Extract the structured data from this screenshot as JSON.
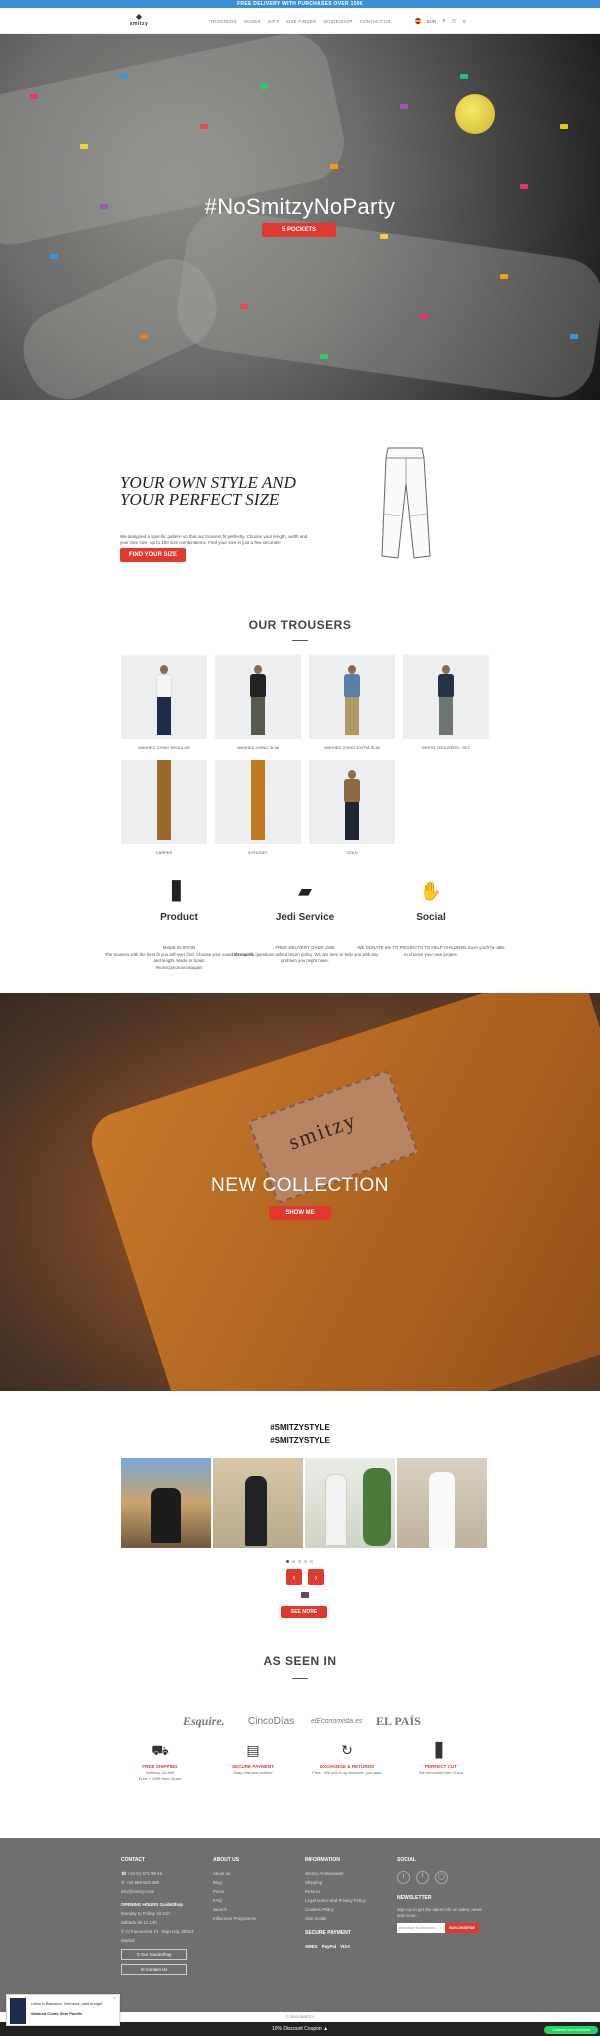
{
  "topbar": {
    "text": "FREE DELIVERY WITH PURCHASES OVER 150€"
  },
  "header": {
    "logo": "smitzy",
    "nav": [
      "TROUSERS",
      "SHOES",
      "GIFT",
      "SIZE FINDER",
      "GUIDESHOP",
      "CONTACT US"
    ],
    "lang": "EUR",
    "cart_count": "0",
    "icons": [
      "spain-flag-icon",
      "search-icon",
      "cart-icon"
    ]
  },
  "hero": {
    "title": "#NoSmitzyNoParty",
    "button": "5 POCKETS"
  },
  "style": {
    "title": "YOUR OWN STYLE AND YOUR PERFECT SIZE",
    "desc": "We designed a specific pattern so that our trousers fit perfectly. Choose your length, width and your own size, up to 150 size combinations. Find your size in just a few seconds!",
    "button": "FIND YOUR SIZE"
  },
  "trousers": {
    "title": "OUR TROUSERS",
    "items": [
      {
        "label": "WASHED CHINO REGULAR"
      },
      {
        "label": "WASHED CHINO SLIM"
      },
      {
        "label": "WASHED CHINO EXTRA SLIM"
      },
      {
        "label": "DRESS TROUSERS - SET"
      },
      {
        "label": "CARPER"
      },
      {
        "label": "5 POCKET"
      },
      {
        "label": "GOLD"
      }
    ]
  },
  "features": [
    {
      "title": "Product",
      "icon": "trousers-icon",
      "lines": [
        "MADE IN SPAIN",
        "The trousers with the best fit you will ever find. Choose your exact size-width and length. Made in Spain",
        "#nomitzynomarcisiagain"
      ]
    },
    {
      "title": "Jedi Service",
      "icon": "vest-icon",
      "lines": [
        "FREE DELIVERY OVER 150€",
        "150 days to questions asked return policy. We are here to help you with any problem you might have."
      ]
    },
    {
      "title": "Social",
      "icon": "hand-icon",
      "lines": [
        "WE DONATE 5% TO PROJECTS TO HELP CHILDREN Soon you'll be able to choose your own project."
      ]
    }
  ],
  "collection": {
    "title": "NEW COLLECTION",
    "button": "SHOW ME",
    "patch": "smitzy"
  },
  "instagram": {
    "title1": "#SMITZYSTYLE",
    "title2": "#SMITZYSTYLE",
    "see_more": "SEE MORE",
    "prev": "‹",
    "next": "›"
  },
  "press": {
    "title": "AS SEEN IN",
    "logos": [
      "Esquire.",
      "CincoDías",
      "elEconomista.es",
      "EL PAÍS"
    ]
  },
  "usps": [
    {
      "title": "FREE SHIPPING",
      "desc": "Delivery 24-48h",
      "desc2": "Free > 150€ from Spain",
      "icon": "truck-icon"
    },
    {
      "title": "SECURE PAYMENT",
      "desc": "Easy, fast and verified",
      "icon": "card-icon"
    },
    {
      "title": "EXCHANGE & RETURNS",
      "desc": "Free - We pick it up wherever you want",
      "icon": "exchange-icon"
    },
    {
      "title": "PERFECT CUT",
      "desc": "We reinvented the Chino",
      "icon": "trousers-icon"
    }
  ],
  "footer": {
    "contact": {
      "title": "CONTACT",
      "phone": "+34 91 572 99 46",
      "whatsapp": "+34 665 810 485",
      "email": "info@smitzy.com",
      "hours_title": "OPENING HOURS GuideShop",
      "hours1": "Monday to Friday 10-21h",
      "hours2": "Sábado de 11-14h",
      "address": "C/ Fuencarral 74 · Bajo Izqi, 28004",
      "city": "Madrid",
      "btn1": "Our GuideShop",
      "btn2": "Contact Us"
    },
    "about": {
      "title": "ABOUT US",
      "links": [
        "About us",
        "Blog",
        "Press",
        "FAQ",
        "Search",
        "Influencer Programme"
      ]
    },
    "info": {
      "title": "INFORMATION",
      "links": [
        "Smitzy Ambassador",
        "Shipping",
        "Returns",
        "Legal notice and Privacy Policy",
        "Cookies Policy",
        "Size Guide"
      ],
      "payment_title": "SECURE PAYMENT",
      "payments": [
        "AMEX",
        "PayPal",
        "VISA"
      ]
    },
    "social": {
      "title": "SOCIAL",
      "nl_title": "NEWSLETTER",
      "nl_text": "Sign up to get the latest info on sales, news and more...",
      "nl_placeholder": "Introduce tu dirección...",
      "nl_button": "SUSCRIBIRSE"
    }
  },
  "copyright": "© 2019 SMITZY",
  "bottombar": "10% Discount Coupon",
  "toast": {
    "line1": "Unha in Barcelon, Gemena, paid bought",
    "line2": "Washed Chino Slim Pacific"
  },
  "chat": "Chatear con nosotros",
  "colors": {
    "accent": "#e03a2f",
    "topbar": "#3b8fd6",
    "footer": "#6f6f6f"
  }
}
